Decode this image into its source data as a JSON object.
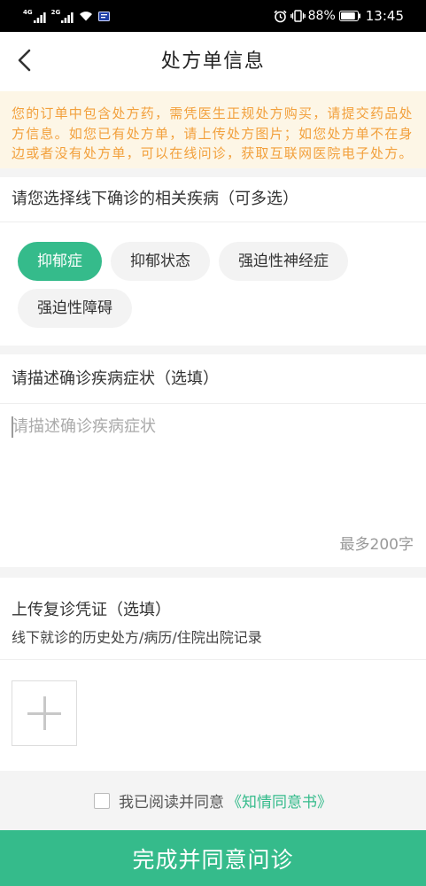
{
  "status_bar": {
    "networks": [
      {
        "label": "4G",
        "icon": "signal-bars-icon"
      },
      {
        "label": "2G",
        "icon": "signal-bars-icon"
      }
    ],
    "wifi_icon": "wifi-icon",
    "notification_icon": "app-notification-icon",
    "alarm_icon": "alarm-clock-icon",
    "vibrate_icon": "vibrate-icon",
    "battery_percent": "88%",
    "battery_icon": "battery-icon",
    "battery_level": 0.88,
    "time": "13:45"
  },
  "header": {
    "back_icon": "chevron-left-icon",
    "title": "处方单信息"
  },
  "notice": {
    "text": "您的订单中包含处方药，需凭医生正规处方购买，请提交药品处方信息。如您已有处方单，请上传处方图片；如您处方单不在身边或者没有处方单，可以在线问诊，获取互联网医院电子处方。"
  },
  "disease_section": {
    "title": "请您选择线下确诊的相关疾病（可多选）",
    "chips": [
      {
        "label": "抑郁症",
        "selected": true
      },
      {
        "label": "抑郁状态",
        "selected": false
      },
      {
        "label": "强迫性神经症",
        "selected": false
      },
      {
        "label": "强迫性障碍",
        "selected": false
      }
    ]
  },
  "symptom_section": {
    "title": "请描述确诊疾病症状（选填）",
    "value": "",
    "placeholder": "请描述确诊疾病症状",
    "limit_text": "最多200字"
  },
  "upload_section": {
    "title": "上传复诊凭证（选填）",
    "subtitle": "线下就诊的历史处方/病历/住院出院记录",
    "add_icon": "plus-icon"
  },
  "agreement": {
    "checked": false,
    "text": "我已阅读并同意",
    "link_text": "《知情同意书》"
  },
  "submit_button": {
    "label": "完成并同意问诊"
  },
  "colors": {
    "accent": "#35bb8b",
    "notice_background": "#fdf6e6",
    "notice_text": "#f2a03c",
    "page_background": "#f4f4f4",
    "chip_background": "#f3f3f3"
  }
}
